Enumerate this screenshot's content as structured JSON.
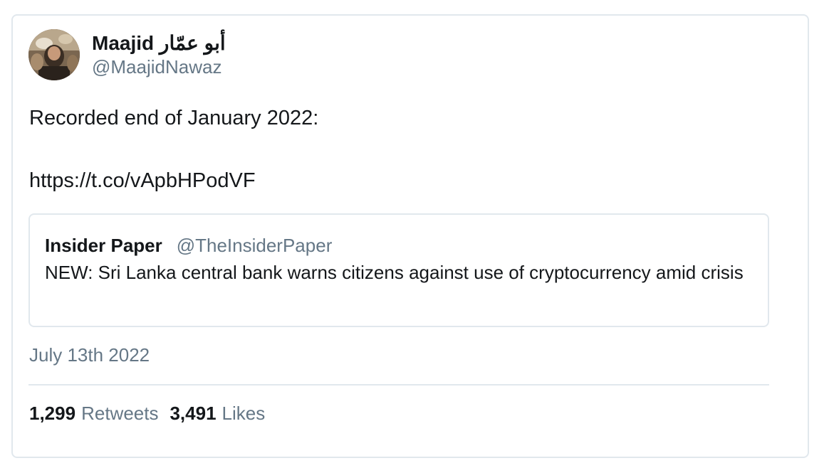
{
  "author": {
    "display_name": "Maajid أبو عمّار",
    "handle": "@MaajidNawaz",
    "avatar_icon": "profile-photo"
  },
  "tweet": {
    "text_line_1": "Recorded end of January 2022:",
    "link": "https://t.co/vApbHPodVF",
    "date": "July 13th 2022"
  },
  "quoted_tweet": {
    "name": "Insider Paper",
    "handle": "@TheInsiderPaper",
    "text": "NEW: Sri Lanka central bank warns citizens against use of cryptocurrency amid crisis"
  },
  "stats": {
    "retweets_count": "1,299",
    "retweets_label": "Retweets",
    "likes_count": "3,491",
    "likes_label": "Likes"
  },
  "colors": {
    "text": "#14171a",
    "secondary": "#657786",
    "border": "#e1e8ed"
  }
}
